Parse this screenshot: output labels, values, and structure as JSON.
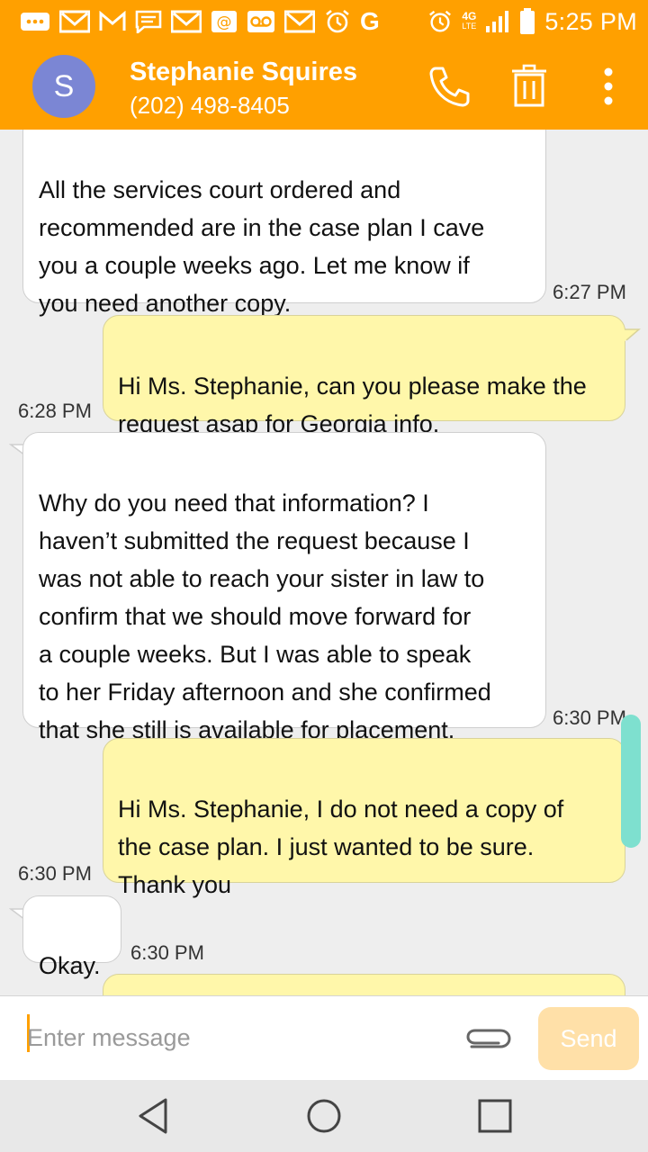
{
  "status_bar": {
    "time": "5:25 PM",
    "carrier_letter": "G",
    "network": "4G",
    "network_sub": "LTE",
    "notification_icons": [
      "more-icon",
      "gmail-icon",
      "gmail-icon",
      "gmail-icon",
      "message-icon",
      "gmail-icon",
      "email-at-icon",
      "voicemail-icon",
      "gmail-icon",
      "alarm-icon",
      "google-icon",
      "alarm-icon",
      "network-4g-icon",
      "signal-icon",
      "battery-icon"
    ]
  },
  "header": {
    "avatar_letter": "S",
    "contact_name": "Stephanie Squires",
    "contact_phone": "(202) 498-8405",
    "accent_color": "#ffa000"
  },
  "messages": [
    {
      "direction": "incoming",
      "text": "All the services court ordered and\nrecommended are in the case plan I cave\nyou a couple weeks ago. Let me know if\nyou need another copy.",
      "time": "6:27 PM"
    },
    {
      "direction": "outgoing",
      "text": "Hi Ms. Stephanie, can you please make the\nrequest asap for Georgia info.",
      "time": "6:28 PM"
    },
    {
      "direction": "incoming",
      "text": "Why do you need that information? I\nhaven’t submitted the request because I\nwas not able to reach your sister in law to\nconfirm that we should move forward for\na couple weeks. But I was able to speak\nto her Friday afternoon and she confirmed\nthat she still is available for placement.",
      "time": "6:30 PM"
    },
    {
      "direction": "outgoing",
      "text": "Hi Ms. Stephanie, I do not need a copy of\nthe case plan. I just wanted to be sure.\nThank you",
      "time": "6:30 PM"
    },
    {
      "direction": "incoming",
      "text": "Okay.",
      "time": "6:30 PM"
    },
    {
      "direction": "outgoing",
      "text": "",
      "time": ""
    }
  ],
  "composer": {
    "placeholder": "Enter message",
    "send_label": "Send"
  },
  "colors": {
    "incoming_bubble": "#ffffff",
    "outgoing_bubble": "#fff7aa",
    "send_disabled": "#ffe0a8",
    "scroll_indicator": "#7ee0cf"
  }
}
